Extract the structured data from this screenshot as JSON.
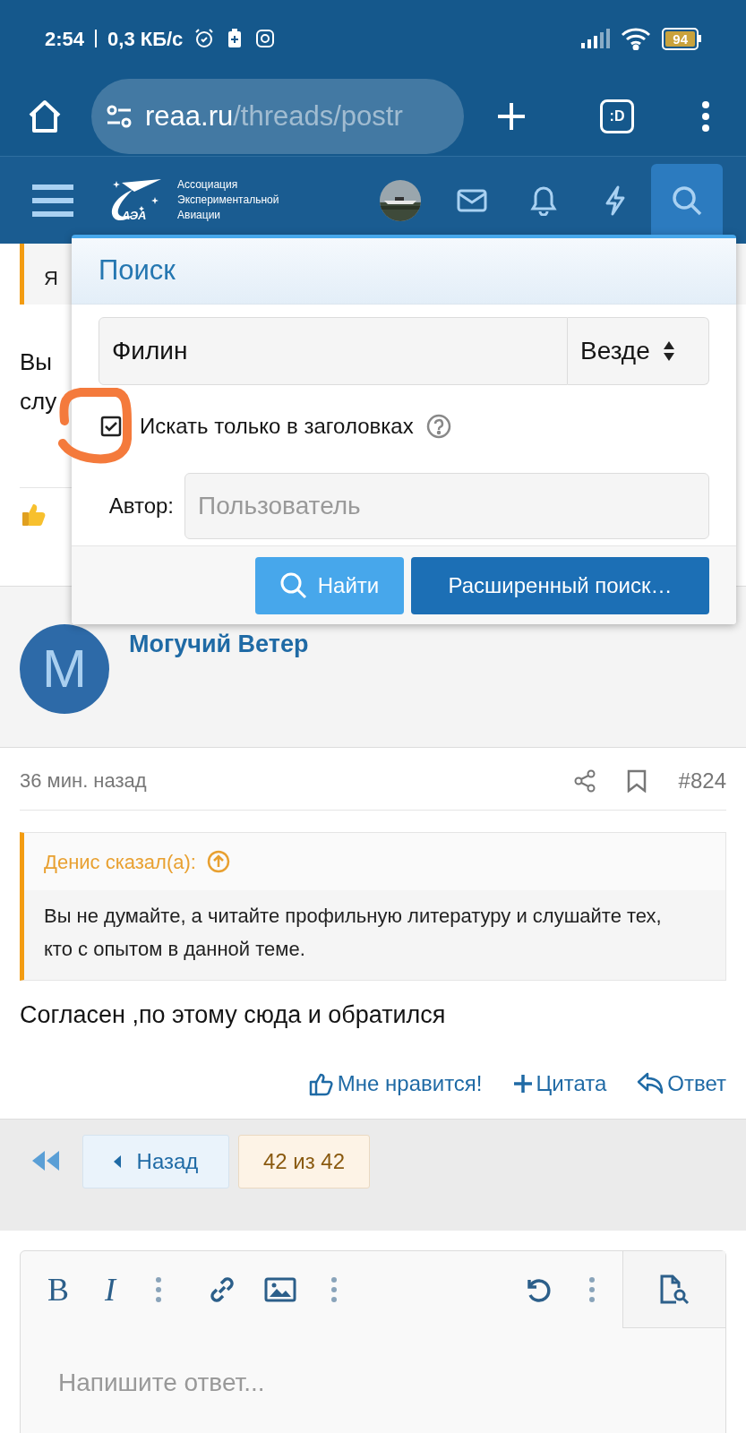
{
  "status_bar": {
    "time": "2:54",
    "speed": "0,3 КБ/с",
    "battery": "94"
  },
  "browser": {
    "url_host": "reaa.ru",
    "url_path": "/threads/postr",
    "tab_label": ":D"
  },
  "site_header": {
    "logo_mark": "АЭА",
    "logo_lines": [
      "Ассоциация",
      "Экспериментальной",
      "Авиации"
    ],
    "nav": [
      {
        "kind": "avatar",
        "selected": false
      },
      {
        "kind": "mail",
        "selected": false
      },
      {
        "kind": "bell",
        "selected": false
      },
      {
        "kind": "bolt",
        "selected": false
      },
      {
        "kind": "search",
        "selected": true
      }
    ]
  },
  "previous_post": {
    "quote_text": "Я",
    "body_lines": [
      "Вы",
      "слу"
    ]
  },
  "search_popup": {
    "title": "Поиск",
    "query": "Филин",
    "scope": "Везде",
    "title_only": {
      "label": "Искать только в заголовках",
      "checked": true
    },
    "author_label": "Автор:",
    "author_placeholder": "Пользователь",
    "buttons": [
      {
        "kind": "search",
        "label": "Найти"
      },
      {
        "kind": "advanced",
        "label": "Расширенный поиск…"
      }
    ]
  },
  "post": {
    "avatar_letter": "M",
    "author": "Могучий Ветер",
    "time": "36 мин. назад",
    "number": "#824",
    "quote_author": "Денис сказал(а):",
    "quote_text": "Вы не думайте, а читайте профильную литературу и слушайте тех, кто с опытом в данной теме.",
    "body": "Согласен ,по этому сюда и обратился",
    "actions": [
      {
        "kind": "like",
        "label": "Мне нравится!"
      },
      {
        "kind": "quote",
        "label": "Цитата"
      },
      {
        "kind": "reply",
        "label": "Ответ"
      }
    ]
  },
  "pagination": {
    "back": "Назад",
    "page": "42 из 42"
  },
  "editor": {
    "bold_label": "B",
    "italic_label": "I",
    "placeholder": "Напишите ответ..."
  }
}
